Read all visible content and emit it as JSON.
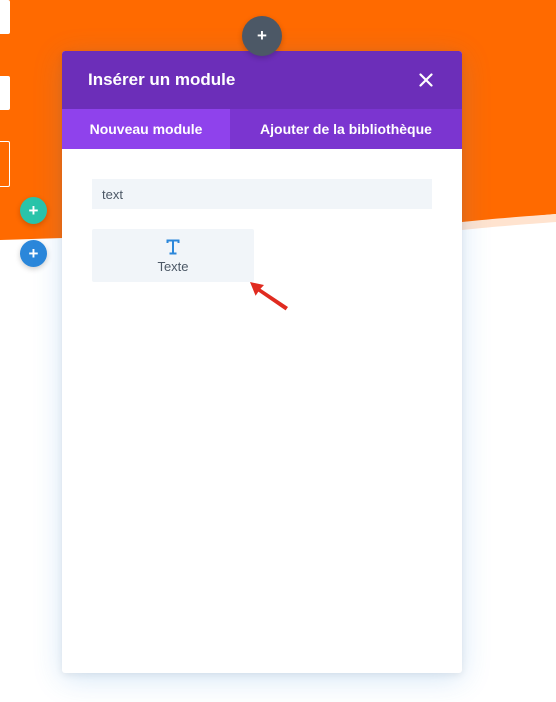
{
  "colors": {
    "orange": "#ff6a00",
    "modal_header": "#6c2eb9",
    "tab_active": "#8f42ec",
    "tab_inactive": "#7b35d0",
    "dark_button": "#4c5866",
    "green_button": "#29c4a9",
    "blue_button": "#2b87da",
    "field_bg": "#f1f5f9",
    "icon_blue": "#2b87da",
    "arrow_red": "#e02b20"
  },
  "modal": {
    "title": "Insérer un module",
    "close_icon": "close-icon"
  },
  "tabs": [
    {
      "label": "Nouveau module",
      "active": true
    },
    {
      "label": "Ajouter de la bibliothèque",
      "active": false
    }
  ],
  "search": {
    "value": "text",
    "placeholder": ""
  },
  "modules": [
    {
      "label": "Texte",
      "icon": "text-icon"
    }
  ],
  "builder_buttons": {
    "top_add": {
      "label": "+",
      "icon": "plus-icon"
    },
    "green_add": {
      "label": "+",
      "icon": "plus-icon"
    },
    "blue_add": {
      "label": "+",
      "icon": "plus-icon"
    }
  }
}
